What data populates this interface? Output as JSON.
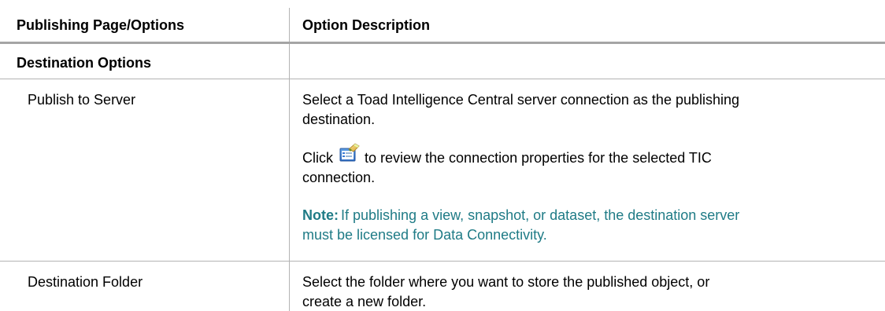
{
  "header": {
    "col1": "Publishing Page/Options",
    "col2": "Option Description"
  },
  "section": {
    "title": "Destination Options"
  },
  "rows": [
    {
      "option": "Publish to Server",
      "desc_line1": "Select a Toad Intelligence Central server connection as the publishing",
      "desc_line2": "destination.",
      "click_prefix": "Click",
      "click_line1_rest": "to review the connection properties for the selected TIC",
      "click_line2": "connection.",
      "note_label": "Note:",
      "note_line1_rest": "If publishing a view, snapshot, or dataset, the destination server",
      "note_line2": "must be licensed for Data Connectivity.",
      "icon": "connection-properties-icon"
    },
    {
      "option": "Destination Folder",
      "desc_line1": "Select the folder where you want to store the published object, or",
      "desc_line2": "create a new folder."
    }
  ],
  "colors": {
    "note": "#1f7b86",
    "border": "#b3b3b3"
  }
}
